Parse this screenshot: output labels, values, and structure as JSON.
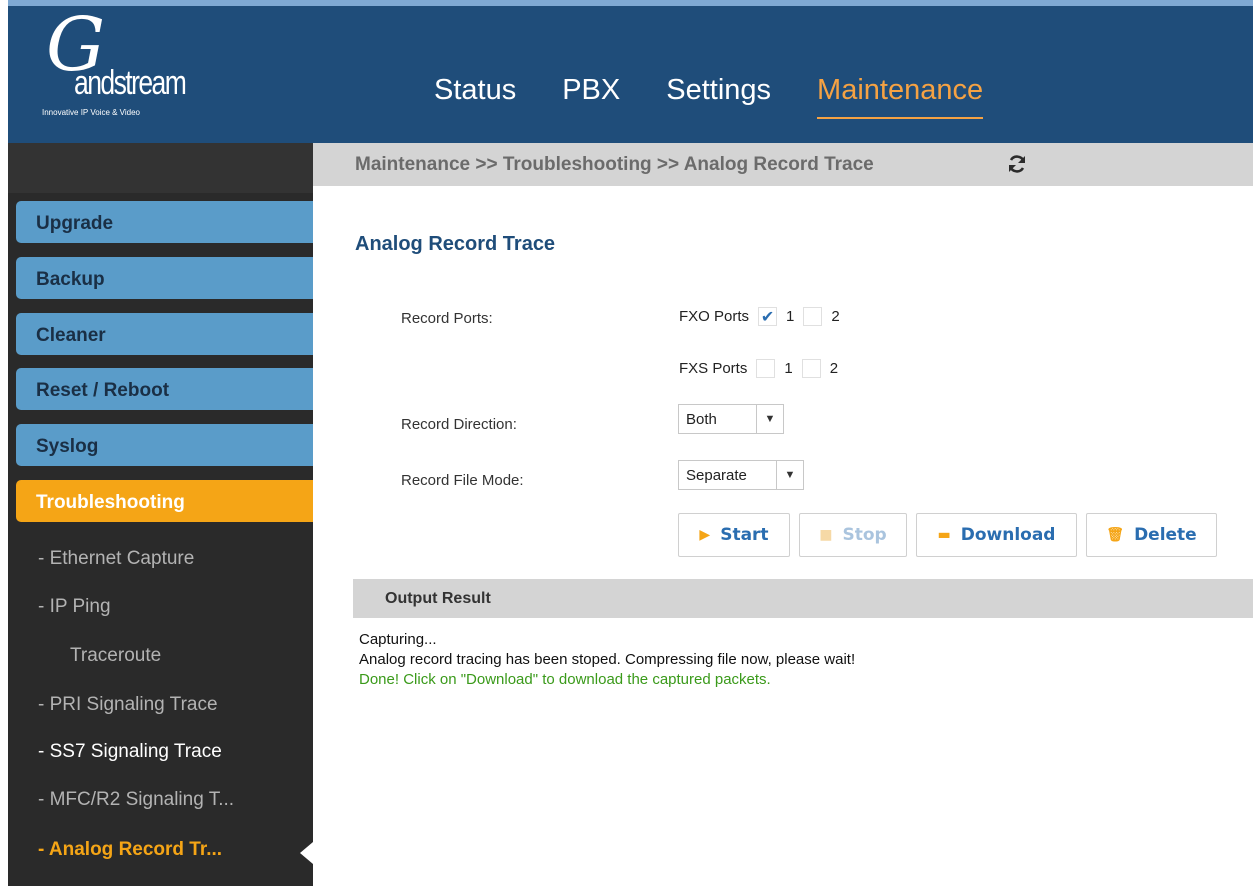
{
  "brand": {
    "logo_text": "andstream",
    "logo_letter": "G",
    "tagline": "Innovative IP Voice & Video"
  },
  "nav": {
    "items": [
      "Status",
      "PBX",
      "Settings",
      "Maintenance"
    ],
    "active": "Maintenance"
  },
  "sidebar": {
    "sections": [
      "Upgrade",
      "Backup",
      "Cleaner",
      "Reset / Reboot",
      "Syslog",
      "Troubleshooting"
    ],
    "active_section": "Troubleshooting",
    "sub_items": [
      "- Ethernet Capture",
      "- IP Ping",
      "Traceroute",
      "- PRI Signaling Trace",
      "- SS7 Signaling Trace",
      "- MFC/R2 Signaling T...",
      "- Analog Record Tr..."
    ],
    "current_sub": "- Analog Record Tr..."
  },
  "breadcrumb": "Maintenance >> Troubleshooting >> Analog Record Trace",
  "page": {
    "title": "Analog Record Trace",
    "record_ports_label": "Record Ports:",
    "fxo": {
      "label": "FXO Ports",
      "port1": "1",
      "port2": "2",
      "port1_checked": true,
      "port2_checked": false
    },
    "fxs": {
      "label": "FXS Ports",
      "port1": "1",
      "port2": "2",
      "port1_checked": false,
      "port2_checked": false
    },
    "direction_label": "Record Direction:",
    "direction_value": "Both",
    "file_mode_label": "Record File Mode:",
    "file_mode_value": "Separate",
    "buttons": {
      "start": "Start",
      "stop": "Stop",
      "download": "Download",
      "delete": "Delete"
    }
  },
  "output": {
    "title": "Output Result",
    "lines": [
      "Capturing...",
      "Analog record tracing has been stoped. Compressing file now, please wait!",
      "Done! Click on \"Download\" to download the captured packets."
    ]
  },
  "colors": {
    "header": "#1f4d7a",
    "accent": "#f5a516",
    "sidebar_btn": "#5a9cc9",
    "link_blue": "#2a6db0",
    "success": "#3a9a1a"
  }
}
